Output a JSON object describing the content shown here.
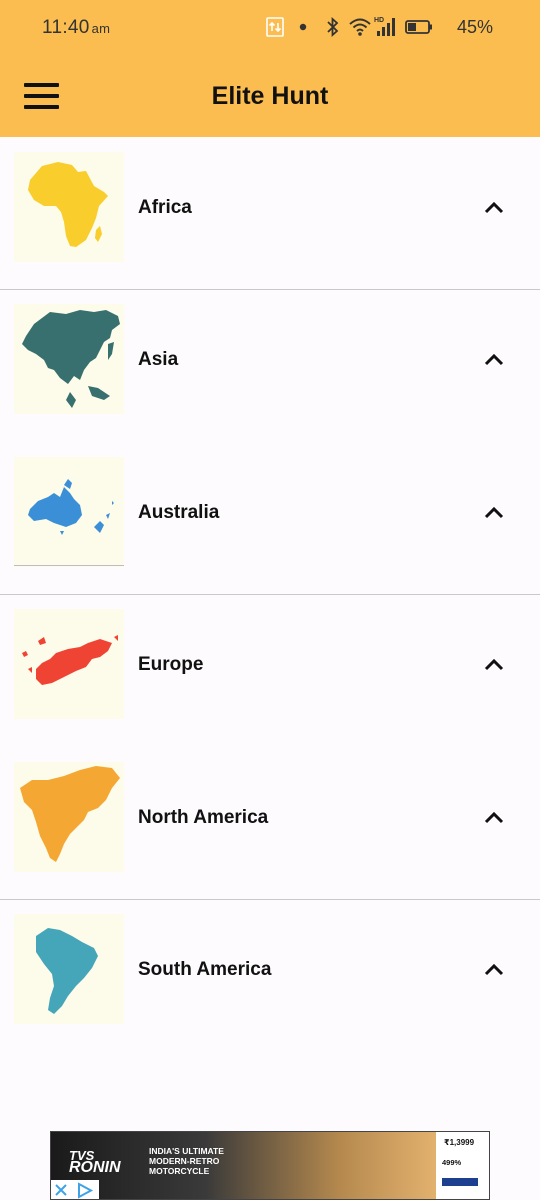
{
  "status_bar": {
    "time": "11:40",
    "ampm": "am",
    "battery": "45%",
    "icons": [
      "data-transfer-icon",
      "dot-icon",
      "bluetooth-icon",
      "wifi-icon",
      "signal-hd-icon",
      "battery-icon"
    ]
  },
  "app_bar": {
    "title": "Elite Hunt",
    "menu_icon": "hamburger-menu-icon"
  },
  "continents": [
    {
      "name": "Africa",
      "color": "#f8cd2c",
      "expand_icon": "chevron-up-icon"
    },
    {
      "name": "Asia",
      "color": "#37706e",
      "expand_icon": "chevron-up-icon"
    },
    {
      "name": "Australia",
      "color": "#3a8fd6",
      "expand_icon": "chevron-up-icon"
    },
    {
      "name": "Europe",
      "color": "#ef4433",
      "expand_icon": "chevron-up-icon"
    },
    {
      "name": "North America",
      "color": "#f5a733",
      "expand_icon": "chevron-up-icon"
    },
    {
      "name": "South America",
      "color": "#44a6b8",
      "expand_icon": "chevron-up-icon"
    }
  ],
  "ad": {
    "brand_small": "TVS",
    "brand_big": "RONIN",
    "headline": "INDIA'S ULTIMATE MODERN-RETRO MOTORCYCLE",
    "price_main": "₹1,3999",
    "price_emi": "499%"
  },
  "colors": {
    "app_bar": "#fbbd4f",
    "background": "#fdfbfd",
    "thumb_bg": "#fdfbea"
  }
}
